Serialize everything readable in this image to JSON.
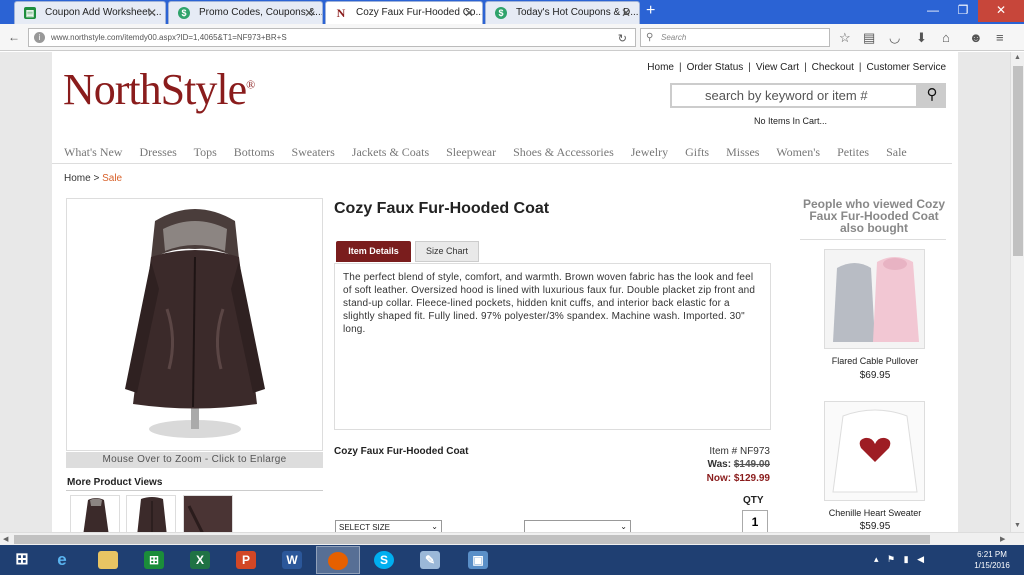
{
  "browser": {
    "tabs": [
      {
        "label": "Coupon Add Worksheet ...",
        "favicon": "sheets-icon",
        "color": "#1e8e3e",
        "active": false
      },
      {
        "label": "Promo Codes, Coupons &...",
        "favicon": "dollar-icon",
        "color": "#2fa36b",
        "active": false
      },
      {
        "label": "Cozy Faux Fur-Hooded Co...",
        "favicon": "northstyle-icon",
        "color": "#8a1c1c",
        "active": true
      },
      {
        "label": "Today's Hot Coupons & D...",
        "favicon": "dollar-icon",
        "color": "#2fa36b",
        "active": false
      }
    ],
    "new_tab": "+",
    "url": "www.northstyle.com/itemdy00.aspx?ID=1,4065&T1=NF973+BR+S",
    "search_placeholder": "Search"
  },
  "site": {
    "logo_text": "NorthStyle",
    "logo_mark": "®",
    "top_links": [
      "Home",
      "Order Status",
      "View Cart",
      "Checkout",
      "Customer Service"
    ],
    "search_placeholder": "search by keyword or item #",
    "cart_status": "No Items In Cart...",
    "categories": [
      "What's New",
      "Dresses",
      "Tops",
      "Bottoms",
      "Sweaters",
      "Jackets & Coats",
      "Sleepwear",
      "Shoes & Accessories",
      "Jewelry",
      "Gifts",
      "Misses",
      "Women's",
      "Petites",
      "Sale"
    ],
    "breadcrumb": {
      "home": "Home",
      "sep": " > ",
      "current": "Sale"
    }
  },
  "product": {
    "title": "Cozy Faux Fur-Hooded Coat",
    "tabs": [
      "Item Details",
      "Size Chart"
    ],
    "description": "The perfect blend of style, comfort, and warmth. Brown woven fabric has the look and feel of soft leather. Oversized hood is lined with luxurious faux fur. Double placket zip front and stand-up collar. Fleece-lined pockets, hidden knit cuffs, and interior back elastic for a slightly shaped fit. Fully lined. 97% polyester/3% spandex. Machine wash. Imported. 30\" long.",
    "zoom_hint": "Mouse Over to Zoom - Click to Enlarge",
    "more_views_label": "More Product Views",
    "item_number_label": "Item # NF973",
    "was_label": "Was:",
    "was_price": "$149.00",
    "now_label": "Now:",
    "now_price": "$129.99",
    "qty_label": "QTY",
    "qty_value": "1",
    "size_select": "SELECT SIZE",
    "color_select": ""
  },
  "also_bought": {
    "heading": "People who viewed Cozy Faux Fur-Hooded Coat also bought",
    "items": [
      {
        "name": "Flared Cable Pullover",
        "price": "$69.95"
      },
      {
        "name": "Chenille Heart Sweater",
        "price": "$59.95"
      }
    ]
  },
  "taskbar": {
    "apps": [
      {
        "name": "start-icon"
      },
      {
        "name": "ie-icon"
      },
      {
        "name": "file-explorer-icon"
      },
      {
        "name": "store-icon"
      },
      {
        "name": "excel-icon"
      },
      {
        "name": "powerpoint-icon"
      },
      {
        "name": "word-icon"
      },
      {
        "name": "firefox-icon"
      },
      {
        "name": "skype-icon"
      },
      {
        "name": "paint-icon"
      },
      {
        "name": "photo-icon"
      }
    ],
    "time": "6:21 PM",
    "date": "1/15/2016"
  }
}
